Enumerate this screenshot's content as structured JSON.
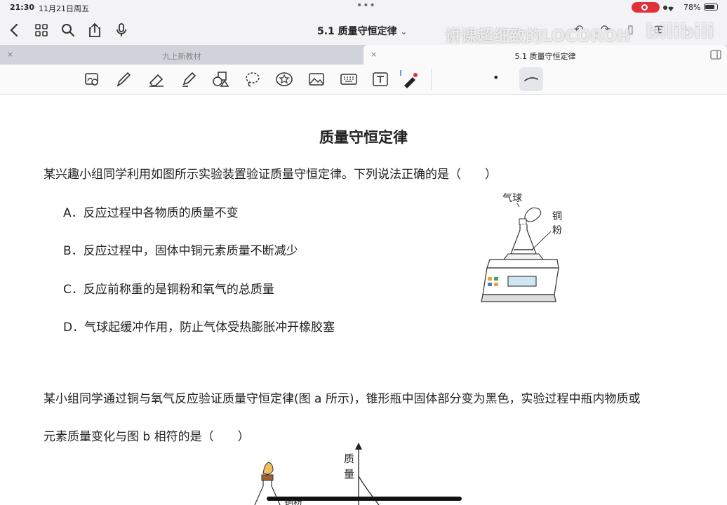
{
  "status_bar": {
    "time": "21:30",
    "date": "11月21日周五",
    "battery": "78%"
  },
  "nav": {
    "title": "5.1 质量守恒定律",
    "chevron": "⌄"
  },
  "watermark": {
    "text": "讲课超细致的LOCOROH",
    "logo": "bilibili"
  },
  "tabs": [
    {
      "label": "九上新教材",
      "close": "×"
    },
    {
      "label": "5.1 质量守恒定律",
      "close": "×"
    }
  ],
  "toolbar": {
    "tools": [
      "lasso-zoom-icon",
      "pen-icon",
      "eraser-icon",
      "highlighter-icon",
      "shapes-icon",
      "lasso-icon",
      "sticker-icon",
      "image-icon",
      "keyboard-icon",
      "text-box-icon",
      "laser-pointer-icon"
    ],
    "dot": "•"
  },
  "document": {
    "title": "质量守恒定律",
    "q1": {
      "stem": "某兴趣小组同学利用如图所示实验装置验证质量守恒定律。下列说法正确的是（　　）",
      "options": [
        "A．反应过程中各物质的质量不变",
        "B．反应过程中，固体中铜元素质量不断减少",
        "C．反应前称重的是铜粉和氧气的总质量",
        "D．气球起缓冲作用，防止气体受热膨胀冲开橡胶塞"
      ],
      "figure_labels": {
        "balloon": "气球",
        "copper_line1": "铜",
        "copper_line2": "粉"
      }
    },
    "q2": {
      "stem_line1": "某小组同学通过铜与氧气反应验证质量守恒定律(图 a 所示)，锥形瓶中固体部分变为黑色，实验过程中瓶内物质或",
      "stem_line2": "元素质量变化与图 b 相符的是（　　）",
      "graph_ylabel_1": "质",
      "graph_ylabel_2": "量",
      "figure_a_label": "铜粉"
    }
  }
}
